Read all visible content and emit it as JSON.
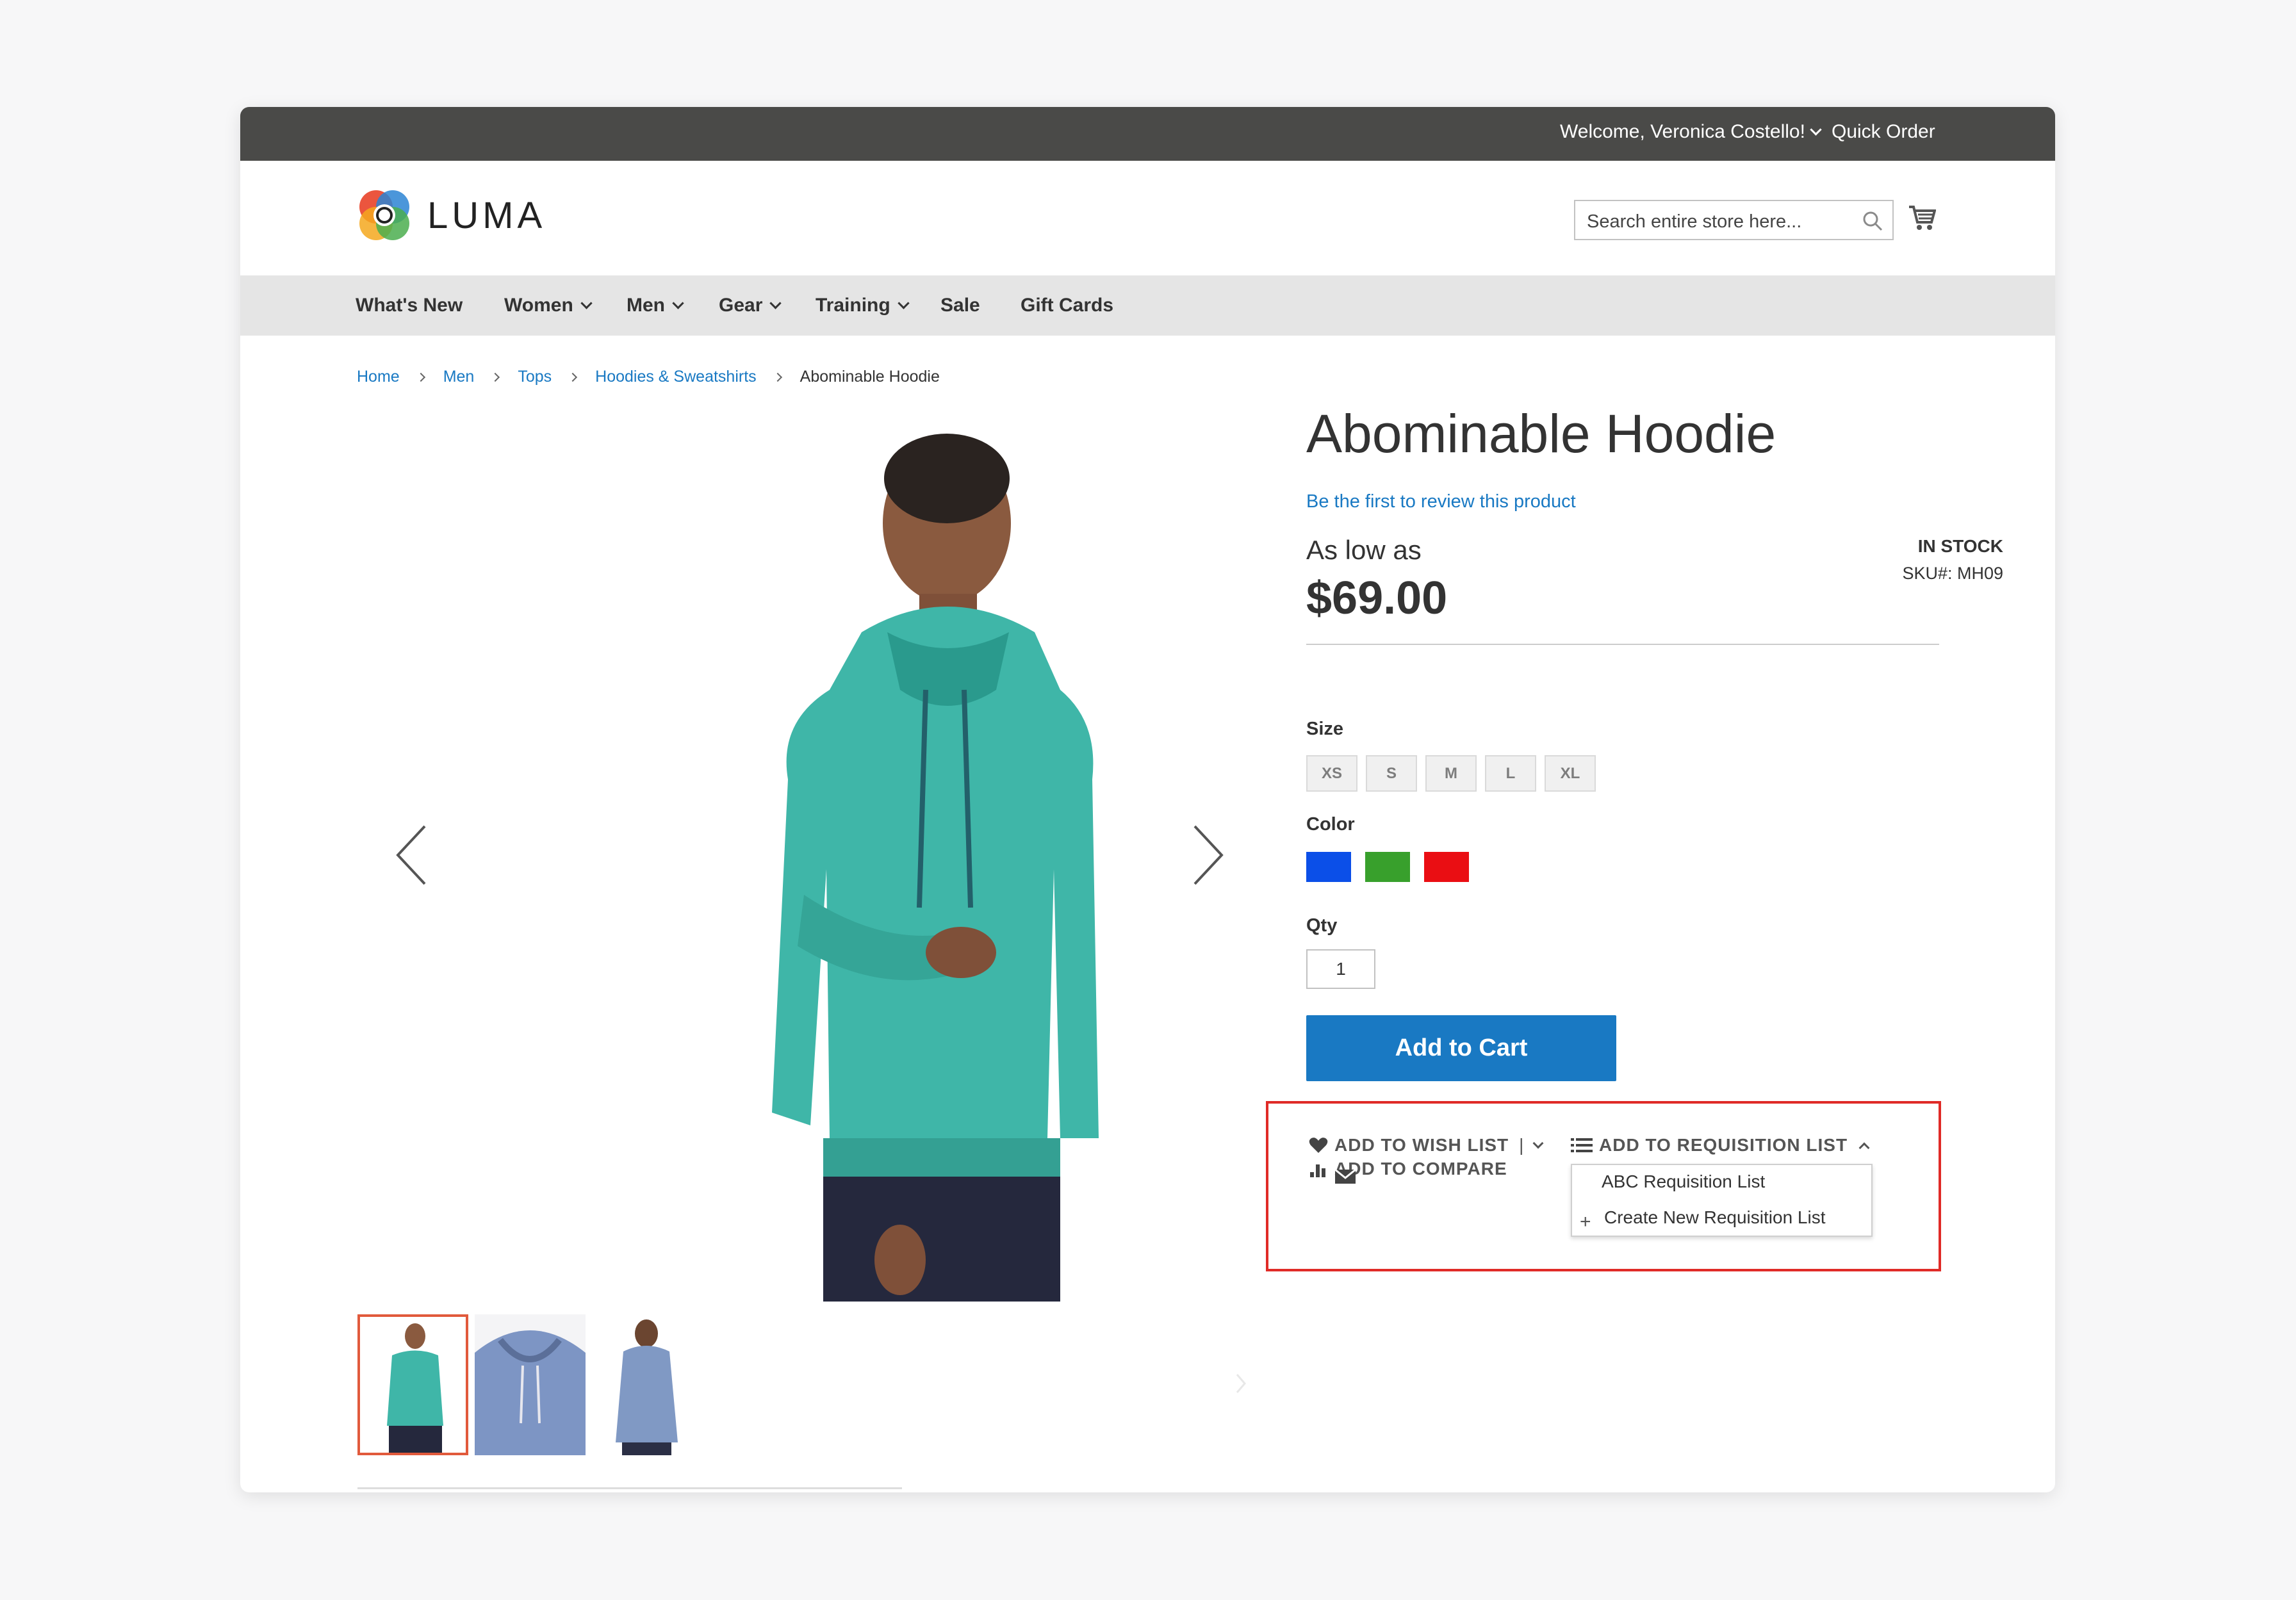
{
  "topbar": {
    "welcome": "Welcome, Veronica Costello!",
    "quick_order": "Quick Order"
  },
  "header": {
    "logo_text": "LUMA",
    "search_placeholder": "Search entire store here..."
  },
  "nav": {
    "items": [
      {
        "label": "What's New"
      },
      {
        "label": "Women"
      },
      {
        "label": "Men"
      },
      {
        "label": "Gear"
      },
      {
        "label": "Training"
      },
      {
        "label": "Sale"
      },
      {
        "label": "Gift Cards"
      }
    ]
  },
  "breadcrumb": [
    "Home",
    "Men",
    "Tops",
    "Hoodies & Sweatshirts",
    "Abominable Hoodie"
  ],
  "product": {
    "title": "Abominable Hoodie",
    "review_link": "Be the first to review this product",
    "price_prefix": "As low as",
    "price": "$69.00",
    "stock": "IN STOCK",
    "sku": "SKU#:  MH09"
  },
  "options": {
    "size_label": "Size",
    "sizes": [
      "XS",
      "S",
      "M",
      "L",
      "XL"
    ],
    "color_label": "Color",
    "colors": [
      "#0b4fe8",
      "#38a02c",
      "#ea0e13"
    ],
    "qty_label": "Qty",
    "qty_value": "1"
  },
  "buttons": {
    "add_to_cart": "Add to Cart"
  },
  "actions": {
    "wish_list": "ADD TO WISH LIST",
    "compare": "ADD TO COMPARE",
    "requisition": "ADD TO REQUISITION LIST",
    "requisition_options": [
      "ABC Requisition List",
      "Create New Requisition List"
    ]
  },
  "colors": {
    "accent": "#1979c3",
    "highlight": "#e02b27",
    "topbar": "#4a4a48"
  }
}
